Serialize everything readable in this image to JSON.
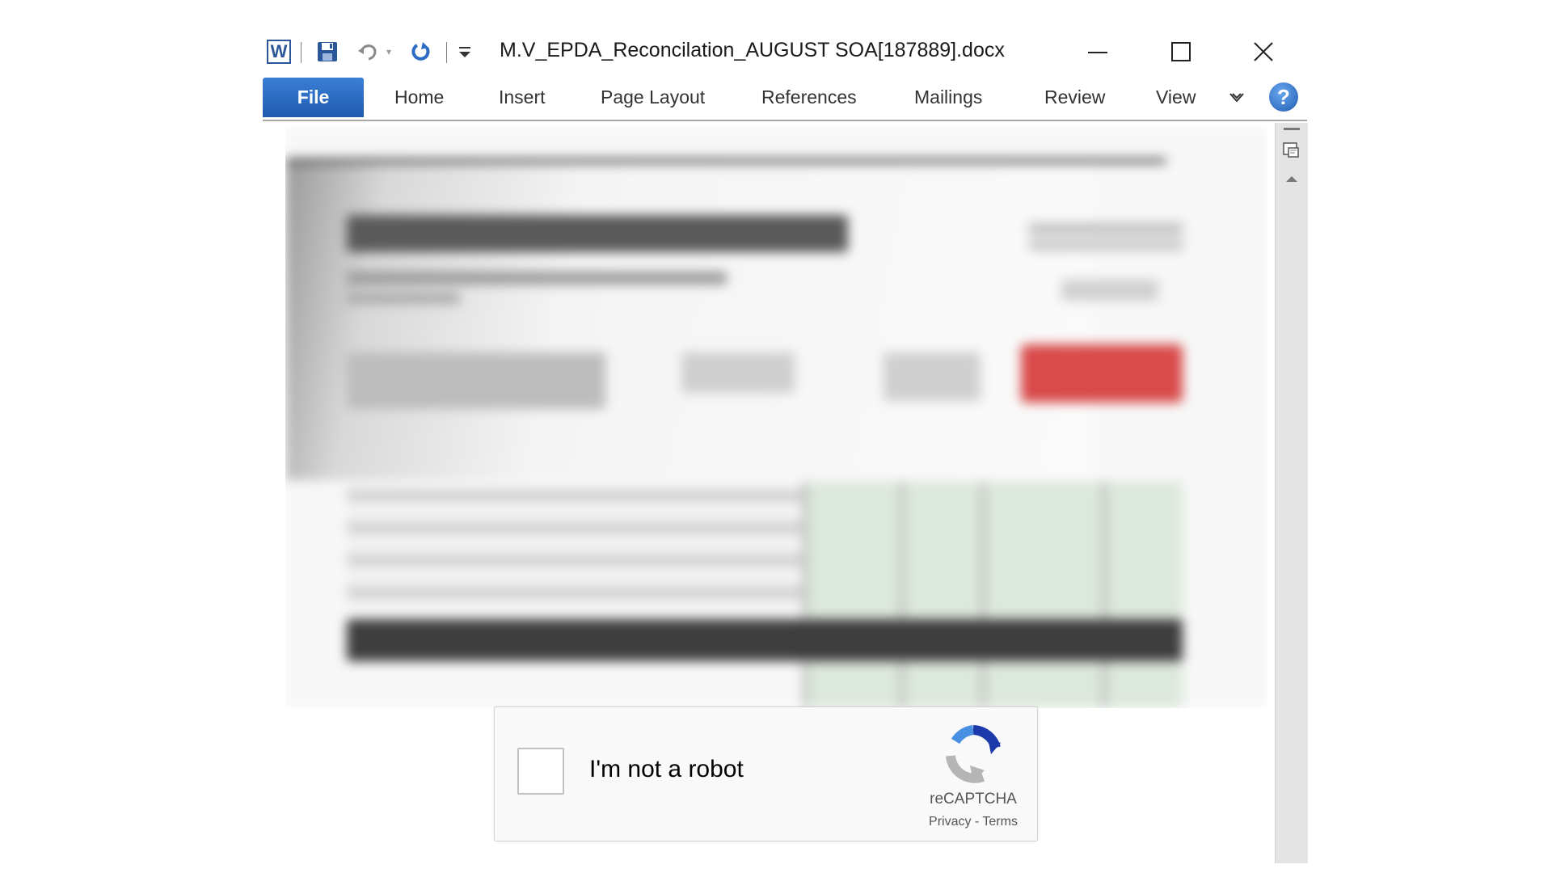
{
  "window": {
    "title": "M.V_EPDA_Reconcilation_AUGUST SOA[187889].docx",
    "app_icon_letter": "W"
  },
  "quick_access": {
    "icons": [
      "word-logo-icon",
      "save-icon",
      "undo-icon",
      "undo-dropdown-icon",
      "redo-icon",
      "customize-toolbar-icon"
    ]
  },
  "window_controls": [
    "minimize-icon",
    "maximize-icon",
    "close-icon"
  ],
  "ribbon": {
    "file_tab": "File",
    "tabs": [
      "Home",
      "Insert",
      "Page Layout",
      "References",
      "Mailings",
      "Review",
      "View"
    ],
    "help_label": "?"
  },
  "recaptcha": {
    "label": "I'm not a robot",
    "brand": "reCAPTCHA",
    "privacy": "Privacy",
    "separator": " - ",
    "terms": "Terms",
    "checked": false
  },
  "colors": {
    "file_tab": "#2b6bc4",
    "word_blue": "#2b579a",
    "recaptcha_blue": "#1c3aa9",
    "recaptcha_gray": "#b5b5b5"
  }
}
